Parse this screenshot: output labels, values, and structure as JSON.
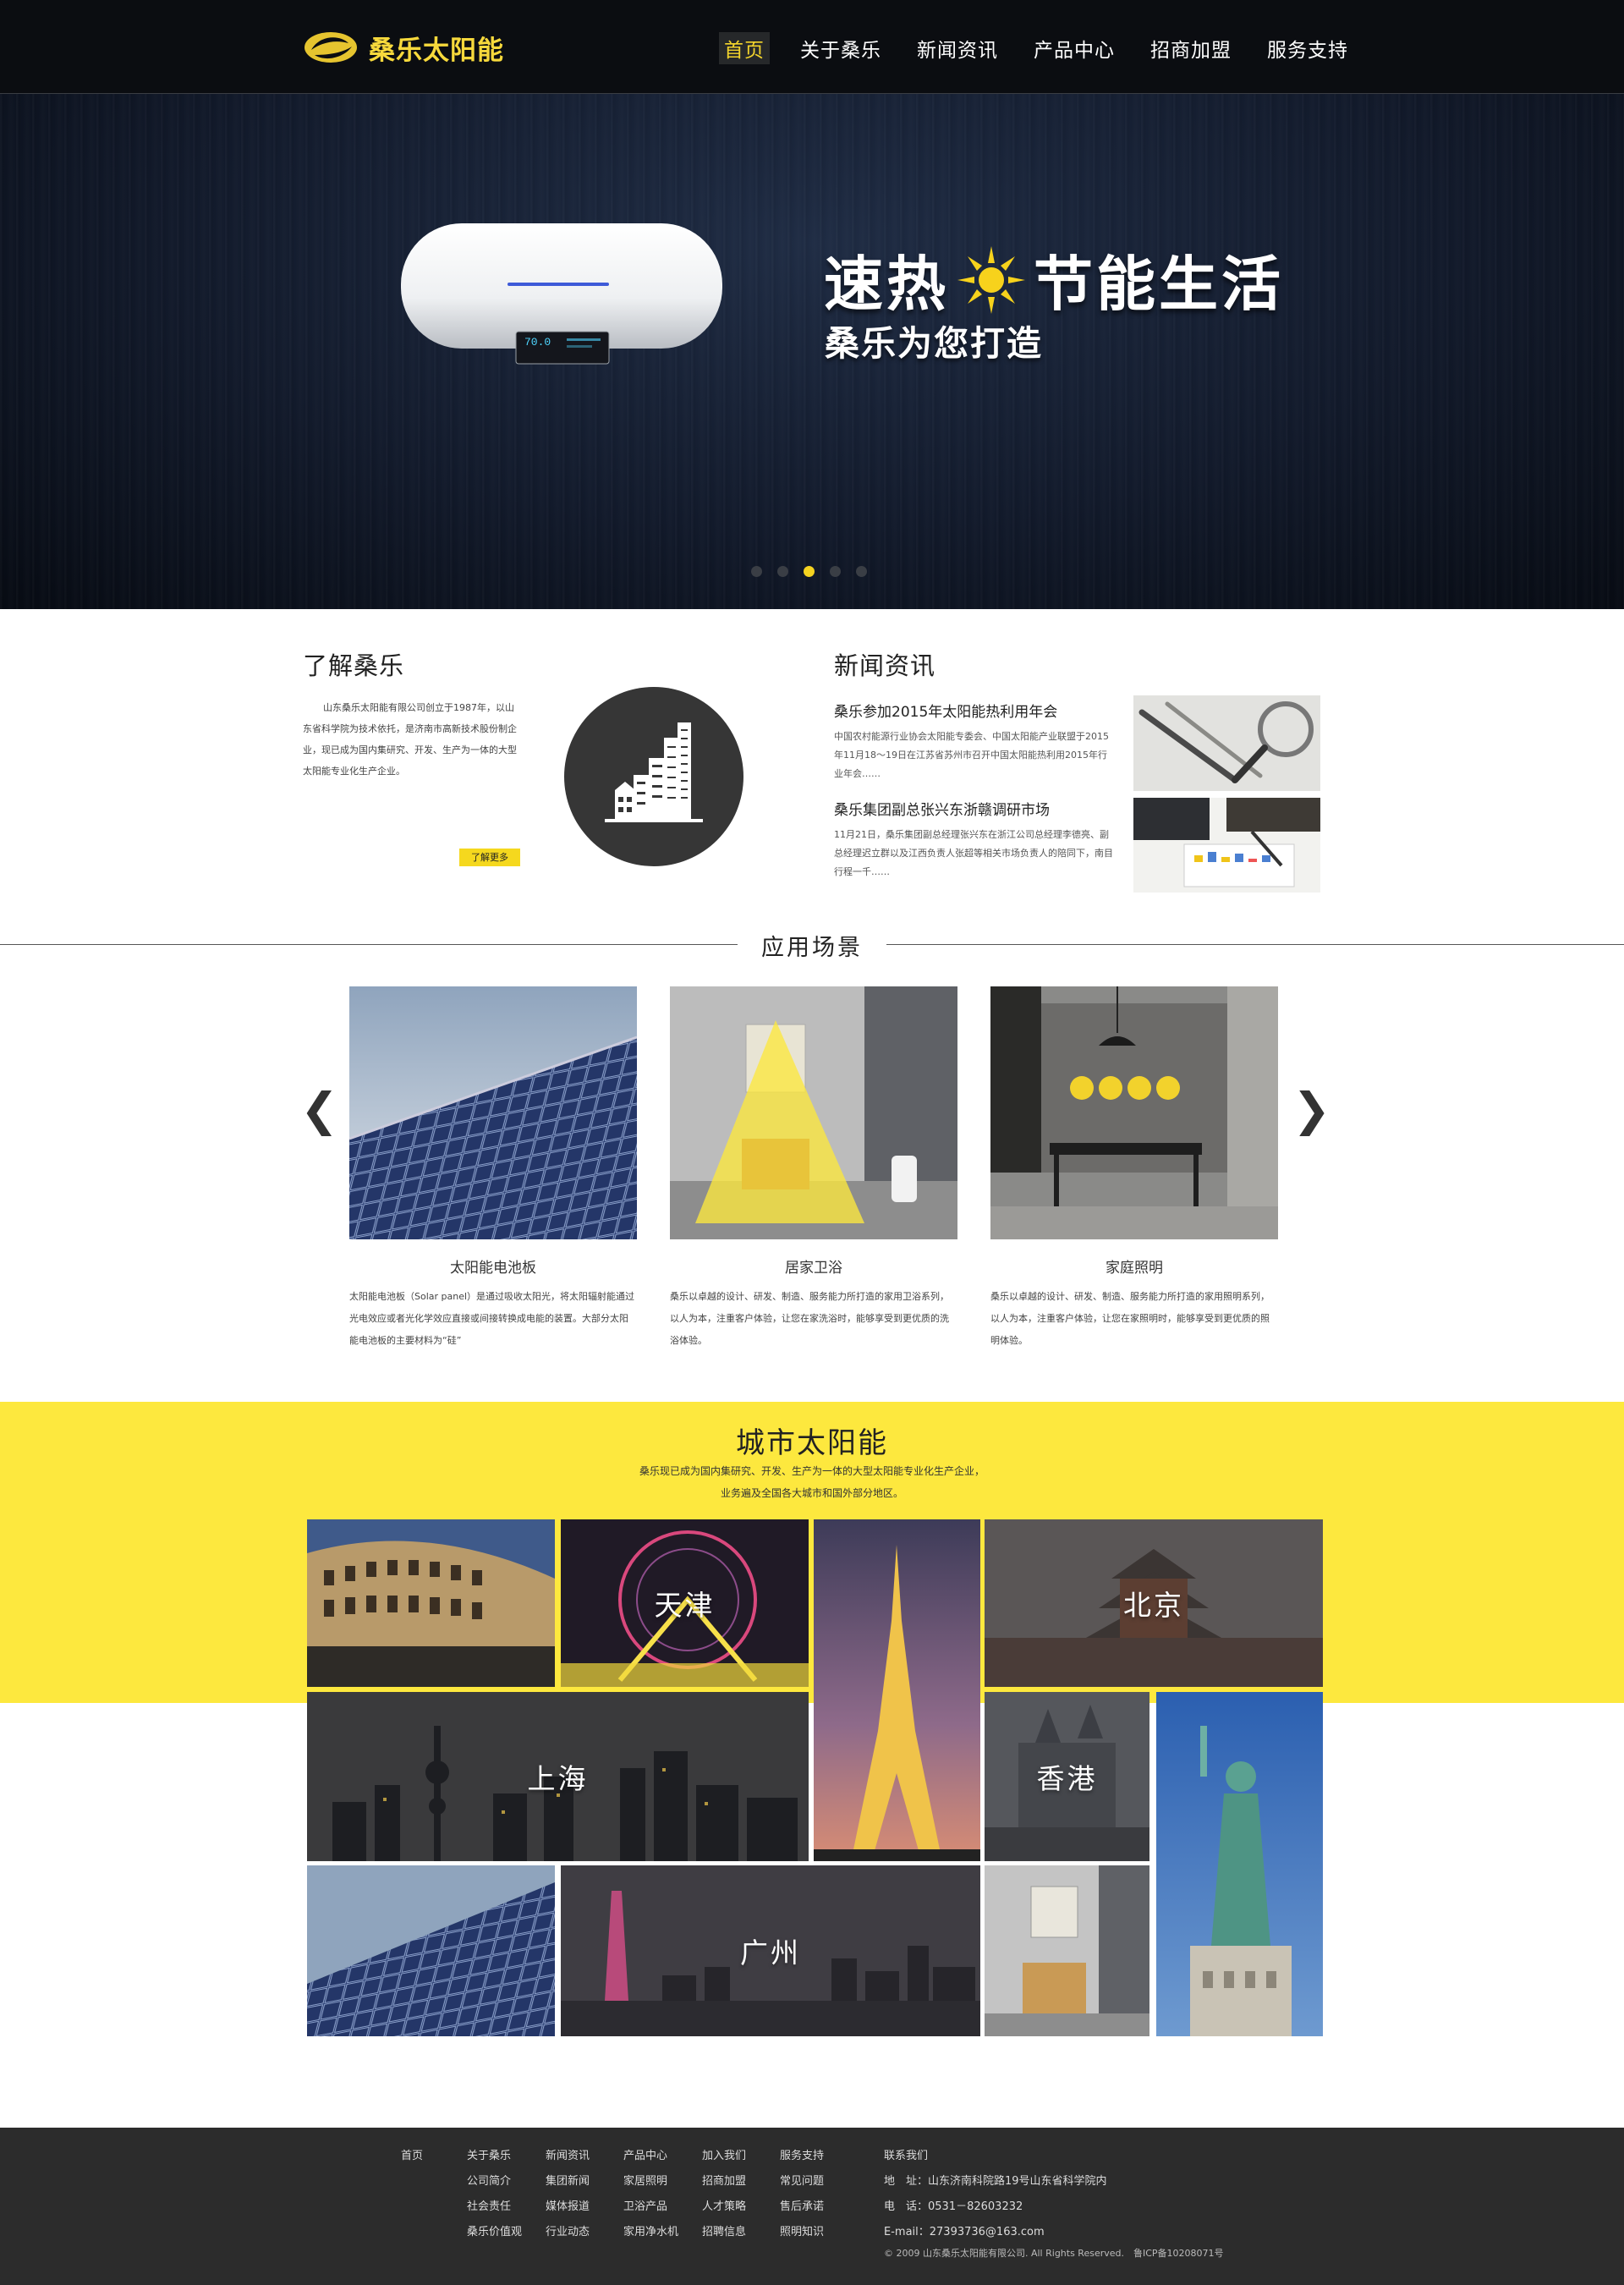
{
  "brand": {
    "name": "桑乐太阳能"
  },
  "nav": {
    "items": [
      "首页",
      "关于桑乐",
      "新闻资讯",
      "产品中心",
      "招商加盟",
      "服务支持"
    ],
    "active": 0
  },
  "hero": {
    "title_left": "速热",
    "title_right": "节能生活",
    "subtitle": "桑乐为您打造",
    "heater_display": "70.0",
    "slides": 5,
    "active_slide": 3
  },
  "about": {
    "title": "了解桑乐",
    "text": "山东桑乐太阳能有限公司创立于1987年，以山东省科学院为技术依托，是济南市高新技术股份制企业，现已成为国内集研究、开发、生产为一体的大型太阳能专业化生产企业。",
    "more_label": "了解更多"
  },
  "news": {
    "title": "新闻资讯",
    "items": [
      {
        "title": "桑乐参加2015年太阳能热利用年会",
        "body": "中国农村能源行业协会太阳能专委会、中国太阳能产业联盟于2015年11月18～19日在江苏省苏州市召开中国太阳能热利用2015年行业年会……"
      },
      {
        "title": "桑乐集团副总张兴东浙赣调研市场",
        "body": "11月21日，桑乐集团副总经理张兴东在浙江公司总经理李德亮、副总经理迟立群以及江西负责人张超等相关市场负责人的陪同下，南目行程一千……"
      }
    ]
  },
  "scenes": {
    "title": "应用场景",
    "prev_label": "❮",
    "next_label": "❯",
    "items": [
      {
        "name": "太阳能电池板",
        "desc": "太阳能电池板（Solar panel）是通过吸收太阳光，将太阳辐射能通过光电效应或者光化学效应直接或间接转换成电能的装置。大部分太阳能电池板的主要材料为“硅”"
      },
      {
        "name": "居家卫浴",
        "desc": "桑乐以卓越的设计、研发、制造、服务能力所打造的家用卫浴系列，以人为本，注重客户体验，让您在家洗浴时，能够享受到更优质的洗浴体验。"
      },
      {
        "name": "家庭照明",
        "desc": "桑乐以卓越的设计、研发、制造、服务能力所打造的家用照明系列，以人为本，注重客户体验，让您在家照明时，能够享受到更优质的照明体验。"
      }
    ]
  },
  "city": {
    "title": "城市太阳能",
    "desc_line1": "桑乐现已成为国内集研究、开发、生产为一体的大型太阳能专业化生产企业，",
    "desc_line2": "业务遍及全国各大城市和国外部分地区。",
    "labels": {
      "tianjin": "天津",
      "beijing": "北京",
      "shanghai": "上海",
      "hongkong": "香港",
      "guangzhou": "广州"
    }
  },
  "footer": {
    "columns": [
      [
        "首页"
      ],
      [
        "关于桑乐",
        "公司简介",
        "社会责任",
        "桑乐价值观"
      ],
      [
        "新闻资讯",
        "集团新闻",
        "媒体报道",
        "行业动态"
      ],
      [
        "产品中心",
        "家居照明",
        "卫浴产品",
        "家用净水机"
      ],
      [
        "加入我们",
        "招商加盟",
        "人才策略",
        "招聘信息"
      ],
      [
        "服务支持",
        "常见问题",
        "售后承诺",
        "照明知识"
      ]
    ],
    "contact_title": "联系我们",
    "address": "地　址：山东济南科院路19号山东省科学院内",
    "phone": "电　话：0531－82603232",
    "email": "E-mail：27393736@163.com",
    "copyright": "© 2009 山东桑乐太阳能有限公司. All Rights Reserved.　鲁ICP备10208071号"
  },
  "colors": {
    "accent": "#f5d81e",
    "header_bg": "#0b0d11",
    "footer_bg": "#2c2c2c",
    "city_band": "#fde83e"
  }
}
